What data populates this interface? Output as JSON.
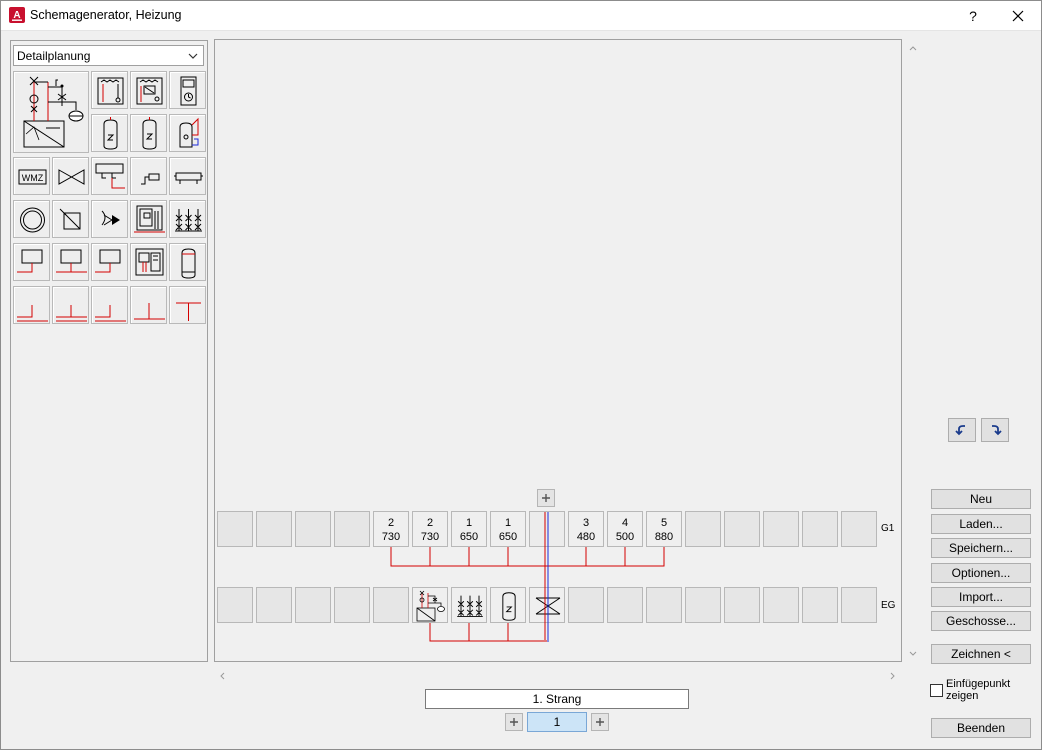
{
  "window": {
    "title": "Schemagenerator, Heizung",
    "help_label": "?"
  },
  "left_panel": {
    "mode_select": {
      "value": "Detailplanung"
    }
  },
  "canvas": {
    "row_g1": {
      "label": "G1",
      "slots": [
        {
          "l1": "",
          "l2": ""
        },
        {
          "l1": "",
          "l2": ""
        },
        {
          "l1": "",
          "l2": ""
        },
        {
          "l1": "",
          "l2": ""
        },
        {
          "l1": "2",
          "l2": "730"
        },
        {
          "l1": "2",
          "l2": "730"
        },
        {
          "l1": "1",
          "l2": "650"
        },
        {
          "l1": "1",
          "l2": "650"
        },
        {
          "l1": "",
          "l2": ""
        },
        {
          "l1": "3",
          "l2": "480"
        },
        {
          "l1": "4",
          "l2": "500"
        },
        {
          "l1": "5",
          "l2": "880"
        },
        {
          "l1": "",
          "l2": ""
        },
        {
          "l1": "",
          "l2": ""
        },
        {
          "l1": "",
          "l2": ""
        },
        {
          "l1": "",
          "l2": ""
        },
        {
          "l1": "",
          "l2": ""
        }
      ]
    },
    "row_eg": {
      "label": "EG"
    }
  },
  "strang": {
    "name": "1. Strang",
    "page": "1"
  },
  "buttons": {
    "neu": "Neu",
    "laden": "Laden...",
    "speichern": "Speichern...",
    "optionen": "Optionen...",
    "import": "Import...",
    "geschosse": "Geschosse...",
    "zeichnen": "Zeichnen <",
    "beenden": "Beenden"
  },
  "einfuegepunkt": {
    "line1": "Einfügepunkt",
    "line2": "zeigen",
    "checked": false
  },
  "colors": {
    "pipe_red": "#d40000",
    "pipe_blue": "#1c2bd8",
    "app_icon_red": "#c8102e"
  }
}
